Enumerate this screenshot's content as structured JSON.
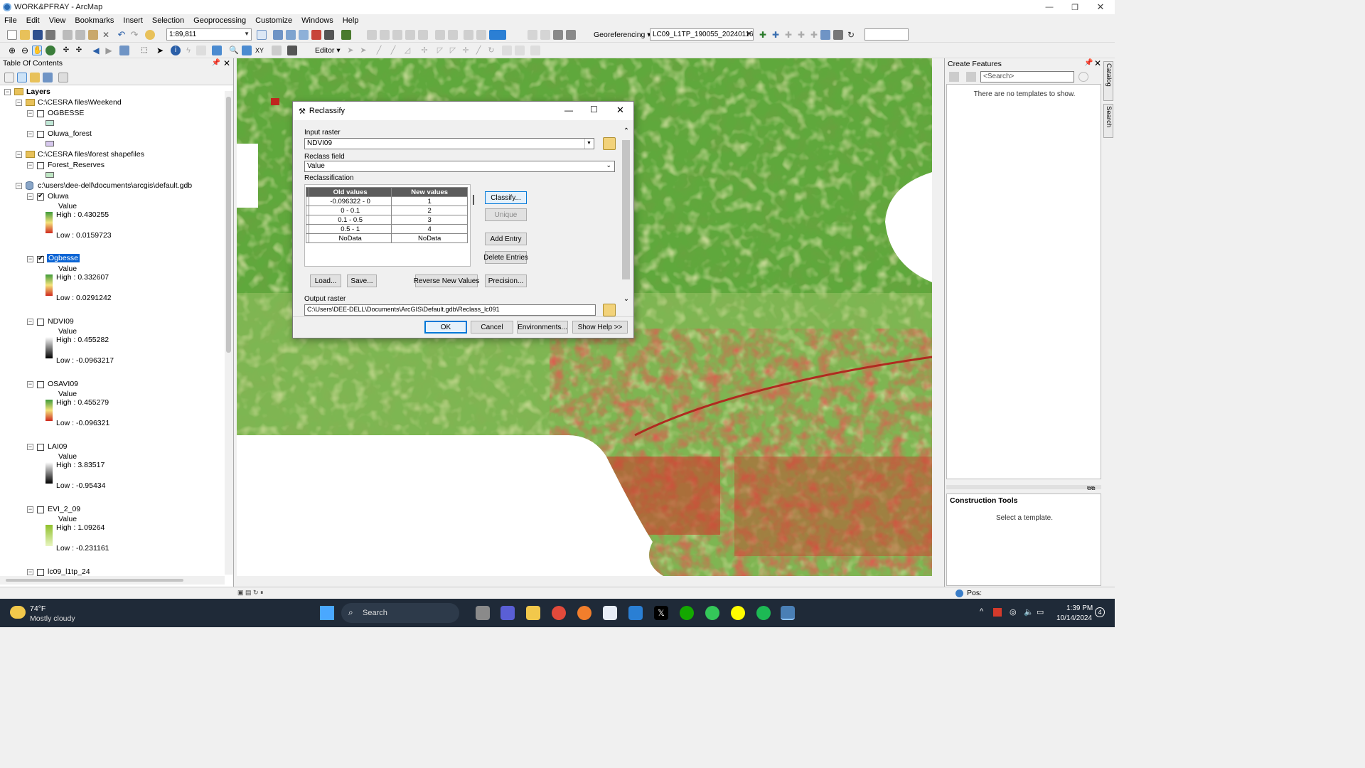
{
  "window": {
    "title": "WORK&PFRAY - ArcMap"
  },
  "menu": [
    "File",
    "Edit",
    "View",
    "Bookmarks",
    "Insert",
    "Selection",
    "Geoprocessing",
    "Customize",
    "Windows",
    "Help"
  ],
  "toolbar": {
    "scale": "1:89,811",
    "georef_label": "Georeferencing ▾",
    "georef_layer": "LC09_L1TP_190055_20240116_",
    "editor_label": "Editor ▾"
  },
  "toc": {
    "title": "Table Of Contents",
    "layers_root": "Layers",
    "groups": [
      {
        "path": "C:\\CESRA files\\Weekend",
        "layers": [
          "OGBESSE",
          "Oluwa_forest"
        ]
      },
      {
        "path": "C:\\CESRA files\\forest shapefiles",
        "layers": [
          "Forest_Reserves"
        ]
      },
      {
        "path": "c:\\users\\dee-dell\\documents\\arcgis\\default.gdb"
      }
    ],
    "rasters": [
      {
        "name": "Oluwa",
        "value": "Value",
        "high": "High : 0.430255",
        "low": "Low : 0.0159723"
      },
      {
        "name": "Ogbesse",
        "value": "Value",
        "high": "High : 0.332607",
        "low": "Low : 0.0291242"
      },
      {
        "name": "NDVI09",
        "value": "Value",
        "high": "High : 0.455282",
        "low": "Low : -0.0963217"
      },
      {
        "name": "OSAVI09",
        "value": "Value",
        "high": "High : 0.455279",
        "low": "Low : -0.096321"
      },
      {
        "name": "LAI09",
        "value": "Value",
        "high": "High : 3.83517",
        "low": "Low : -0.95434"
      },
      {
        "name": "EVI_2_09",
        "value": "Value",
        "high": "High : 1.09264",
        "low": "Low : -0.231161"
      },
      {
        "name": "lc09_l1tp_24"
      }
    ]
  },
  "create_features": {
    "title": "Create Features",
    "search_placeholder": "<Search>",
    "empty_msg": "There are no templates to show.",
    "construction_title": "Construction Tools",
    "construction_msg": "Select a template."
  },
  "side_tabs": [
    "Catalog",
    "Search"
  ],
  "dialog": {
    "title": "Reclassify",
    "input_raster_label": "Input raster",
    "input_raster_value": "NDVI09",
    "reclass_field_label": "Reclass field",
    "reclass_field_value": "Value",
    "reclassification_label": "Reclassification",
    "col_old": "Old values",
    "col_new": "New values",
    "rows": [
      {
        "old": "-0.096322 - 0",
        "new": "1"
      },
      {
        "old": "0 - 0.1",
        "new": "2"
      },
      {
        "old": "0.1 - 0.5",
        "new": "3"
      },
      {
        "old": "0.5 - 1",
        "new": "4"
      },
      {
        "old": "NoData",
        "new": "NoData"
      }
    ],
    "btn_classify": "Classify...",
    "btn_unique": "Unique",
    "btn_add_entry": "Add Entry",
    "btn_delete_entries": "Delete Entries",
    "btn_load": "Load...",
    "btn_save": "Save...",
    "btn_reverse": "Reverse New Values",
    "btn_precision": "Precision...",
    "output_raster_label": "Output raster",
    "output_raster_value": "C:\\Users\\DEE-DELL\\Documents\\ArcGIS\\Default.gdb\\Reclass_lc091",
    "btn_ok": "OK",
    "btn_cancel": "Cancel",
    "btn_env": "Environments...",
    "btn_help": "Show Help >>"
  },
  "status": {
    "pos_label": "Pos:"
  },
  "taskbar": {
    "weather_temp": "74°F",
    "weather_desc": "Mostly cloudy",
    "search_label": "Search",
    "time": "1:39 PM",
    "date": "10/14/2024",
    "notif_count": "4"
  },
  "colors": {
    "accent": "#0078d7",
    "selection": "#3399ff",
    "map_green": "#4c9a2a",
    "map_red": "#c0261e"
  }
}
